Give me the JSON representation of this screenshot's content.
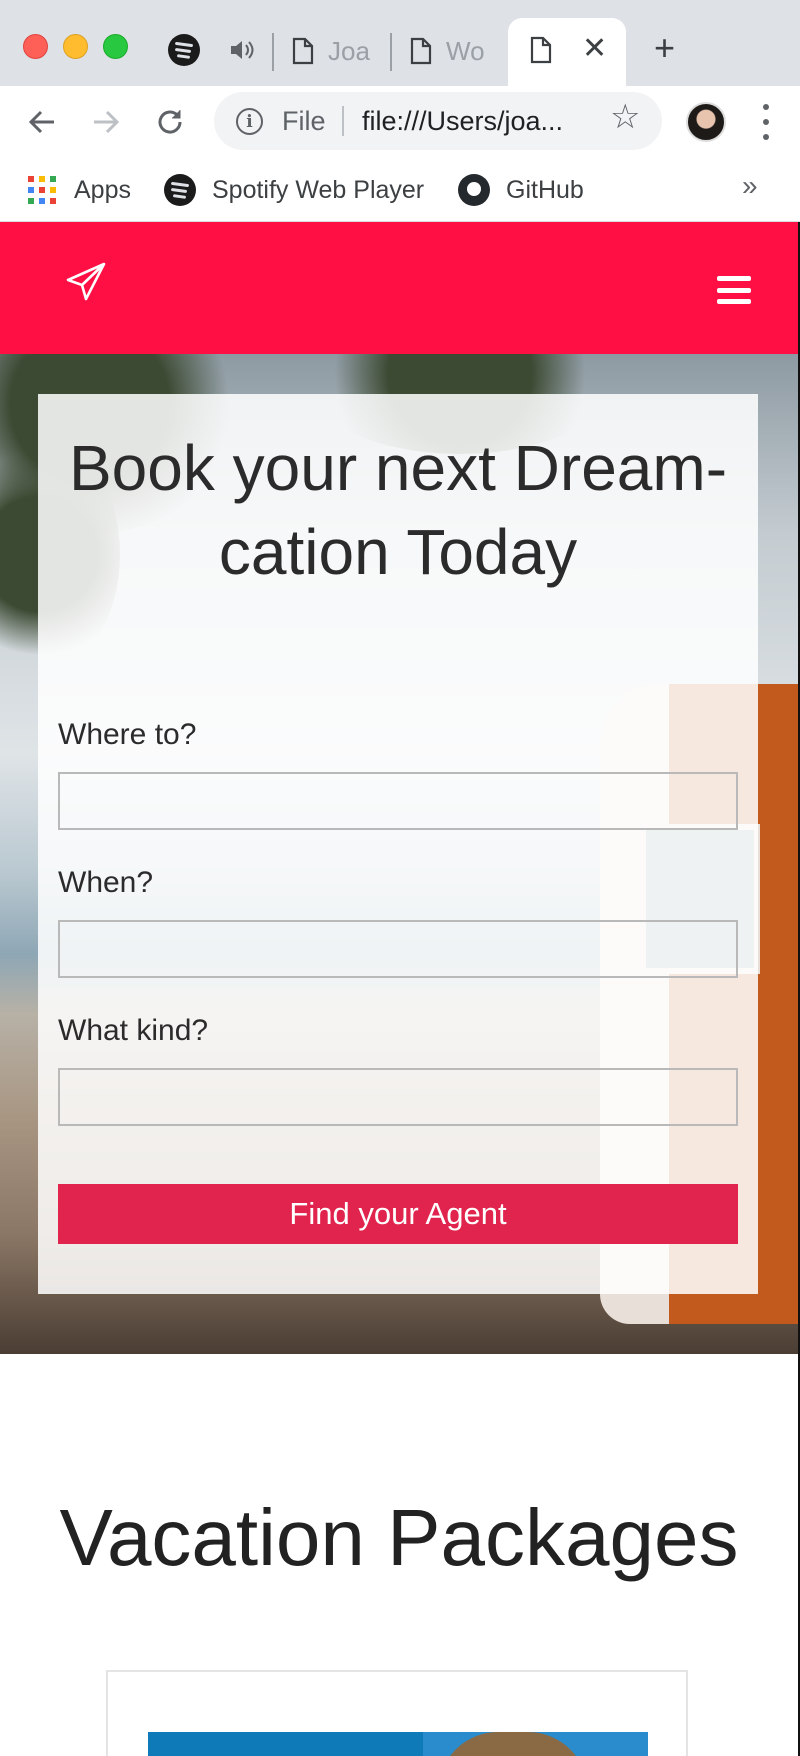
{
  "browser": {
    "tabs": [
      {
        "title": "Joa"
      },
      {
        "title": "Wo"
      }
    ],
    "active_tab_close": "✕",
    "new_tab": "+",
    "address_bar": {
      "scheme": "File",
      "url": "file:///Users/joa..."
    },
    "bookmarks": [
      {
        "label": "Apps"
      },
      {
        "label": "Spotify Web Player"
      },
      {
        "label": "GitHub"
      }
    ],
    "bookmarks_more": "»"
  },
  "page": {
    "navbar": {
      "color": "#ff0f43"
    },
    "booking": {
      "title": "Book your next Dream-cation Today",
      "fields": [
        {
          "label": "Where to?",
          "value": ""
        },
        {
          "label": "When?",
          "value": ""
        },
        {
          "label": "What kind?",
          "value": ""
        }
      ],
      "submit": "Find your Agent"
    },
    "packages": {
      "title": "Vacation Packages"
    }
  }
}
